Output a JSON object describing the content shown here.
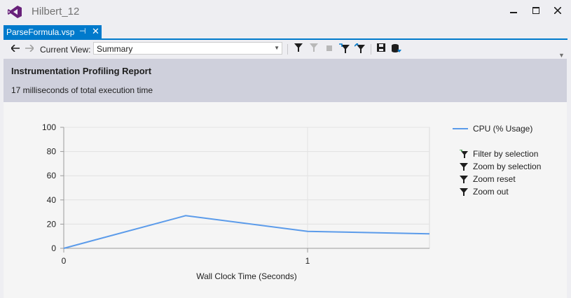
{
  "window": {
    "title": "Hilbert_12"
  },
  "tab": {
    "label": "ParseFormula.vsp",
    "pin_icon": "pin-icon",
    "close_icon": "close-icon"
  },
  "toolbar": {
    "current_view_label": "Current View:",
    "current_view_value": "Summary"
  },
  "report": {
    "title": "Instrumentation Profiling Report",
    "subtitle": "17 milliseconds of total execution time"
  },
  "legend": {
    "series_label": "CPU (% Usage)"
  },
  "actions": [
    {
      "label": "Filter by selection"
    },
    {
      "label": "Zoom by selection"
    },
    {
      "label": "Zoom reset"
    },
    {
      "label": "Zoom out"
    }
  ],
  "colors": {
    "accent": "#007acc",
    "header_band": "#cfd0dc",
    "series": "#5b9bea"
  },
  "chart_data": {
    "type": "line",
    "xlabel": "Wall Clock Time (Seconds)",
    "ylabel": "",
    "ylim": [
      0,
      100
    ],
    "xlim": [
      0,
      1.5
    ],
    "yticks": [
      0,
      20,
      40,
      60,
      80,
      100
    ],
    "xticks": [
      0,
      1
    ],
    "grid": true,
    "legend_position": "right",
    "series": [
      {
        "name": "CPU (% Usage)",
        "x": [
          0,
          0.5,
          1.0,
          1.5
        ],
        "y": [
          0,
          27,
          14,
          12
        ]
      }
    ]
  }
}
